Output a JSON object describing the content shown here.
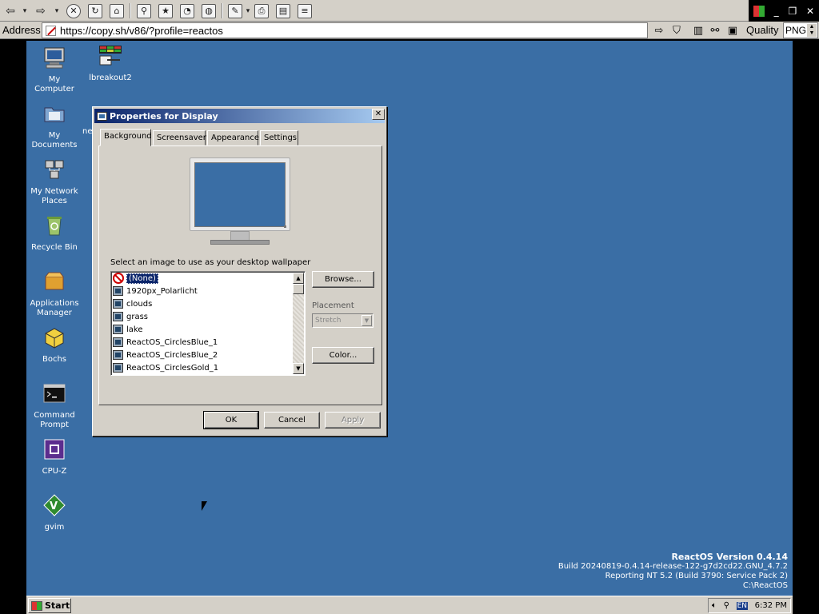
{
  "browser": {
    "address_label": "Address",
    "url": "https://copy.sh/v86/?profile=reactos",
    "quality_label": "Quality",
    "format_value": "PNG"
  },
  "desktop": {
    "icons": [
      {
        "label": "My\nComputer",
        "name": "my-computer"
      },
      {
        "label": "My\nDocuments",
        "name": "my-documents"
      },
      {
        "label": "My Network\nPlaces",
        "name": "my-network-places"
      },
      {
        "label": "Recycle Bin",
        "name": "recycle-bin"
      },
      {
        "label": "Applications\nManager",
        "name": "applications-manager"
      },
      {
        "label": "Bochs",
        "name": "bochs"
      },
      {
        "label": "Command\nPrompt",
        "name": "command-prompt"
      },
      {
        "label": "CPU-Z",
        "name": "cpu-z"
      },
      {
        "label": "gvim",
        "name": "gvim"
      },
      {
        "label": "lbreakout2",
        "name": "lbreakout2"
      }
    ],
    "partial_icon_label": "ne",
    "version": {
      "title": "ReactOS Version 0.4.14",
      "build": "Build 20240819-0.4.14-release-122-g7d2cd22.GNU_4.7.2",
      "reporting": "Reporting NT 5.2 (Build 3790: Service Pack 2)",
      "path": "C:\\ReactOS"
    }
  },
  "taskbar": {
    "start_label": "Start",
    "language": "EN",
    "clock": "6:32 PM"
  },
  "dialog": {
    "title": "Properties for Display",
    "tabs": [
      "Background",
      "Screensaver",
      "Appearance",
      "Settings"
    ],
    "active_tab": "Background",
    "wallpaper_label": "Select an image to use as your desktop wallpaper",
    "wallpapers": [
      "(None)",
      "1920px_Polarlicht",
      "clouds",
      "grass",
      "lake",
      "ReactOS_CirclesBlue_1",
      "ReactOS_CirclesBlue_2",
      "ReactOS_CirclesGold_1"
    ],
    "selected_wallpaper": "(None)",
    "browse_label": "Browse...",
    "placement_label": "Placement",
    "placement_value": "Stretch",
    "color_label": "Color...",
    "ok_label": "OK",
    "cancel_label": "Cancel",
    "apply_label": "Apply",
    "preview_color": "#3a6ea5"
  }
}
